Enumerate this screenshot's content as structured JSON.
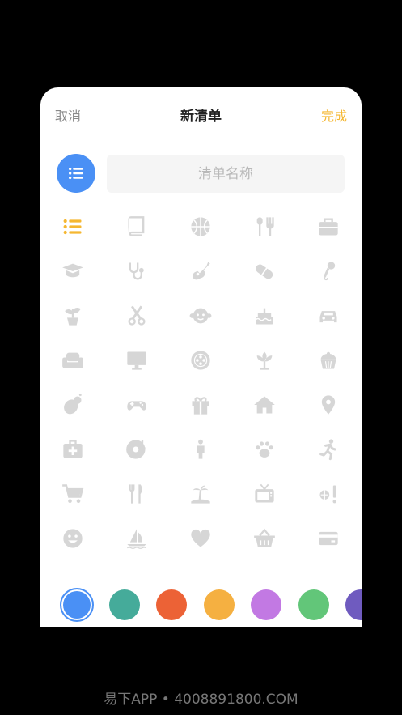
{
  "header": {
    "cancel_label": "取消",
    "title": "新清单",
    "done_label": "完成"
  },
  "name_field": {
    "placeholder": "清单名称",
    "value": ""
  },
  "selected_icon": "list-icon",
  "selected_color": "#4a90f5",
  "icon_default_color": "#d6d6d6",
  "icon_active_color": "#f5b731",
  "icon_rows": [
    [
      "list-icon",
      "book-icon",
      "basketball-icon",
      "cutlery-icon",
      "briefcase-icon"
    ],
    [
      "graduation-cap-icon",
      "stethoscope-icon",
      "guitar-icon",
      "pill-icon",
      "microphone-icon"
    ],
    [
      "potted-plant-icon",
      "scissors-icon",
      "baby-face-icon",
      "cake-icon",
      "car-icon"
    ],
    [
      "sofa-icon",
      "monitor-icon",
      "film-reel-icon",
      "lotus-icon",
      "cupcake-icon"
    ],
    [
      "vegetables-icon",
      "gamepad-icon",
      "gift-icon",
      "home-icon",
      "location-pin-icon"
    ],
    [
      "first-aid-kit-icon",
      "music-disc-icon",
      "person-icon",
      "paw-icon",
      "running-man-icon"
    ],
    [
      "shopping-cart-icon",
      "fork-knife-icon",
      "island-icon",
      "tv-icon",
      "ball-exclamation-icon"
    ],
    [
      "smiley-icon",
      "sailboat-icon",
      "heart-icon",
      "basket-icon",
      "credit-card-icon"
    ]
  ],
  "colors": [
    "#4a90f5",
    "#45ab9a",
    "#ec6236",
    "#f5b041",
    "#c279e3",
    "#62c679",
    "#6f5bbf"
  ],
  "footer_text": "易下APP • 4008891800.COM"
}
